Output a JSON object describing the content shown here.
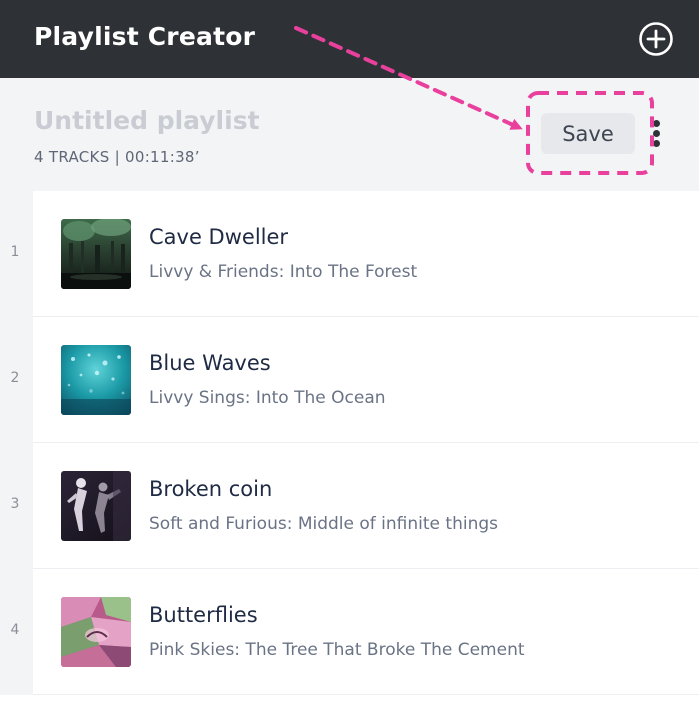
{
  "header": {
    "title": "Playlist Creator",
    "add_icon": "plus-circle-icon"
  },
  "playlist": {
    "name": "Untitled playlist",
    "meta": "4 TRACKS | 00:11:38’",
    "save_label": "Save",
    "more_icon": "vertical-ellipsis-icon"
  },
  "tracks": [
    {
      "number": "1",
      "title": "Cave Dweller",
      "subtitle": "Livvy & Friends: Into The Forest",
      "art": "forest-cave-thumbnail"
    },
    {
      "number": "2",
      "title": "Blue Waves",
      "subtitle": "Livvy Sings: Into The Ocean",
      "art": "ocean-water-thumbnail"
    },
    {
      "number": "3",
      "title": "Broken coin",
      "subtitle": "Soft and Furious: Middle of infinite things",
      "art": "dancers-thumbnail"
    },
    {
      "number": "4",
      "title": "Butterflies",
      "subtitle": "Pink Skies: The Tree That Broke The Cement",
      "art": "pink-abstract-thumbnail"
    }
  ],
  "colors": {
    "header_bg": "#2e3236",
    "subheader_bg": "#f3f4f6",
    "annotation": "#e8409c",
    "title_text": "#1f2a44"
  }
}
